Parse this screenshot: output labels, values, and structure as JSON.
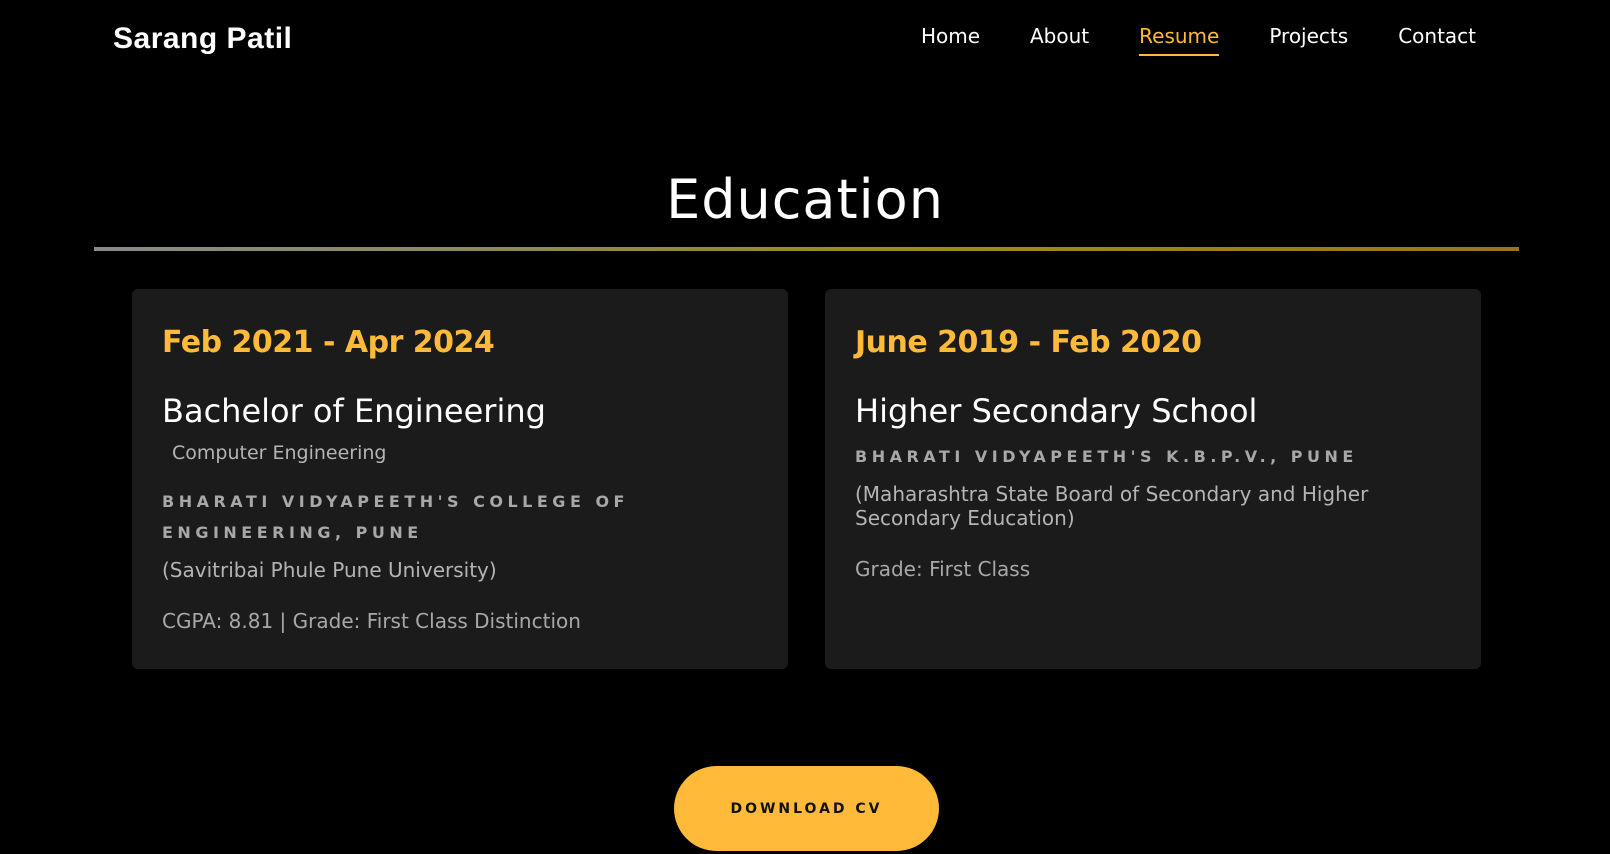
{
  "brand": "Sarang Patil",
  "nav": {
    "items": [
      "Home",
      "About",
      "Resume",
      "Projects",
      "Contact"
    ],
    "active": "Resume"
  },
  "section": {
    "title": "Education"
  },
  "education": [
    {
      "date": "Feb 2021 - Apr 2024",
      "degree": "Bachelor of Engineering",
      "field": "Computer Engineering",
      "school": "BHARATI VIDYAPEETH'S COLLEGE OF ENGINEERING, PUNE",
      "board": "(Savitribai Phule Pune University)",
      "grade": "CGPA: 8.81 | Grade: First Class Distinction"
    },
    {
      "date": "June 2019 - Feb 2020",
      "degree": "Higher Secondary School",
      "school": "BHARATI VIDYAPEETH'S K.B.P.V., PUNE",
      "board": "(Maharashtra State Board of Secondary and Higher Secondary Education)",
      "grade": "Grade: First Class"
    }
  ],
  "download_button": "DOWNLOAD CV",
  "colors": {
    "background": "#000000",
    "card": "#1b1b1b",
    "accent": "#ffba3a",
    "text": "#ffffff",
    "muted": "#b4b4b4"
  }
}
